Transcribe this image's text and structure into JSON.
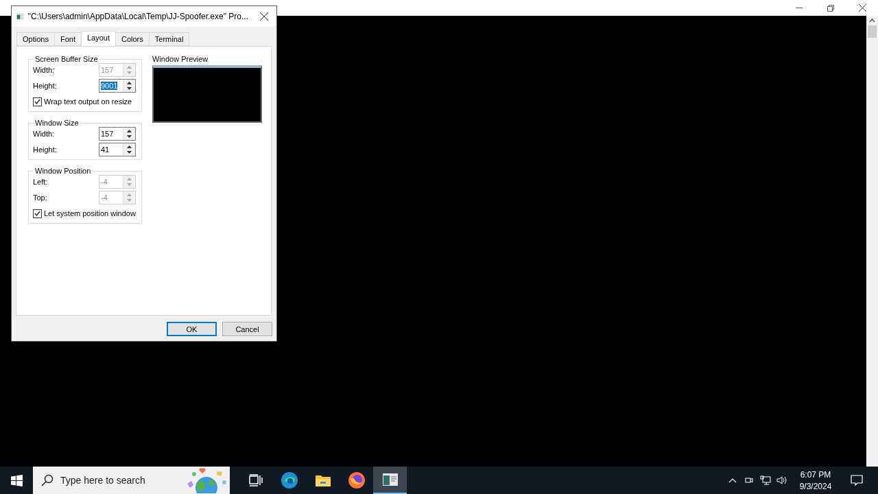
{
  "dialog": {
    "title": "\"C:\\Users\\admin\\AppData\\Local\\Temp\\JJ-Spoofer.exe\" Pro...",
    "tabs": [
      {
        "label": "Options",
        "selected": false
      },
      {
        "label": "Font",
        "selected": false
      },
      {
        "label": "Layout",
        "selected": true
      },
      {
        "label": "Colors",
        "selected": false
      },
      {
        "label": "Terminal",
        "selected": false
      }
    ],
    "groups": [
      {
        "title": "Screen Buffer Size",
        "fields": [
          {
            "label": "Width:",
            "value": "157",
            "disabled": true,
            "text_selected": false
          },
          {
            "label": "Height:",
            "value": "9001",
            "disabled": false,
            "text_selected": true
          }
        ],
        "checkbox": {
          "label": "Wrap text output on resize",
          "checked": true
        }
      },
      {
        "title": "Window Size",
        "fields": [
          {
            "label": "Width:",
            "value": "157",
            "disabled": false,
            "text_selected": false
          },
          {
            "label": "Height:",
            "value": "41",
            "disabled": false,
            "text_selected": false
          }
        ]
      },
      {
        "title": "Window Position",
        "fields": [
          {
            "label": "Left:",
            "value": "-4",
            "disabled": true,
            "text_selected": false
          },
          {
            "label": "Top:",
            "value": "-4",
            "disabled": true,
            "text_selected": false
          }
        ],
        "checkbox": {
          "label": "Let system position window",
          "checked": true
        }
      }
    ],
    "preview": {
      "title": "Window Preview"
    },
    "buttons": [
      {
        "label": "OK",
        "default": true
      },
      {
        "label": "Cancel",
        "default": false
      }
    ]
  },
  "taskbar": {
    "search": {
      "placeholder": "Type here to search"
    },
    "apps": [
      {
        "kind": "task-view",
        "active": false
      },
      {
        "kind": "edge",
        "active": false
      },
      {
        "kind": "explorer",
        "active": false
      },
      {
        "kind": "firefox",
        "active": false
      },
      {
        "kind": "console",
        "active": true
      }
    ],
    "clock": {
      "time": "6:07 PM",
      "date": "9/3/2024"
    }
  }
}
